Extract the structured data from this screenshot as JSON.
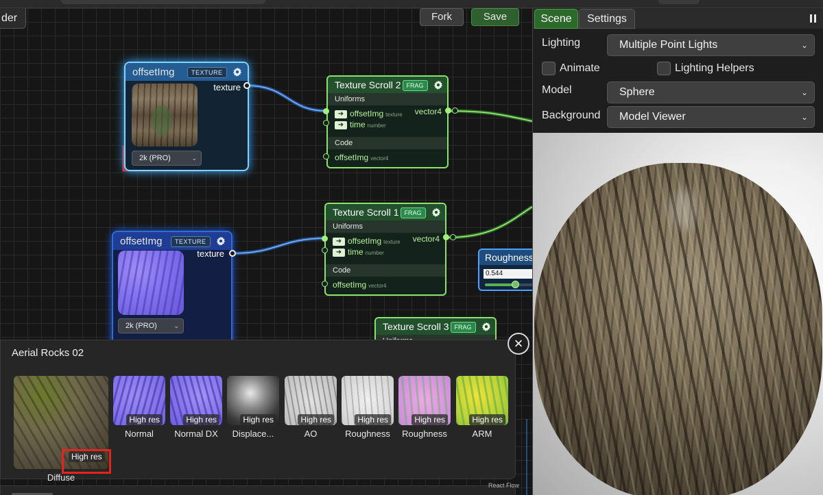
{
  "editor": {
    "tab_label": "der",
    "fork_label": "Fork",
    "save_label": "Save",
    "attribution": "React Flow"
  },
  "texture_nodes": [
    {
      "title": "offsetImg",
      "badge": "TEXTURE",
      "output": "texture",
      "resolution": "2k (PRO)",
      "thumbnail": "bark-texture",
      "selected": true
    },
    {
      "title": "offsetImg",
      "badge": "TEXTURE",
      "output": "texture",
      "resolution": "2k (PRO)",
      "thumbnail": "normal-map-texture",
      "selected": false
    }
  ],
  "shader_nodes": [
    {
      "title": "Texture Scroll 2",
      "badge": "FRAG",
      "uniforms_label": "Uniforms",
      "uniforms": [
        {
          "name": "offsetImg",
          "type": "texture"
        },
        {
          "name": "time",
          "type": "number"
        }
      ],
      "output": "vector4",
      "code_label": "Code",
      "code_input": {
        "name": "offsetImg",
        "type": "vector4"
      }
    },
    {
      "title": "Texture Scroll 1",
      "badge": "FRAG",
      "uniforms_label": "Uniforms",
      "uniforms": [
        {
          "name": "offsetImg",
          "type": "texture"
        },
        {
          "name": "time",
          "type": "number"
        }
      ],
      "output": "vector4",
      "code_label": "Code",
      "code_input": {
        "name": "offsetImg",
        "type": "vector4"
      }
    },
    {
      "title": "Texture Scroll 3",
      "badge": "FRAG",
      "uniforms_label": "Uniforms"
    }
  ],
  "roughness_node": {
    "title": "Roughness",
    "value": "0.544",
    "level": 0.544
  },
  "asset_panel": {
    "title": "Aerial Rocks 02",
    "close_icon": "close-icon",
    "maps": [
      {
        "label": "Diffuse",
        "badge": "High res",
        "kind": "diffuse"
      },
      {
        "label": "Normal",
        "badge": "High res",
        "kind": "normal"
      },
      {
        "label": "Normal DX",
        "badge": "High res",
        "kind": "normal-dx"
      },
      {
        "label": "Displace...",
        "badge": "High res",
        "kind": "displacement"
      },
      {
        "label": "AO",
        "badge": "High res",
        "kind": "ao"
      },
      {
        "label": "Roughness",
        "badge": "High res",
        "kind": "roughness"
      },
      {
        "label": "Roughness",
        "badge": "High res",
        "kind": "roughness-alt"
      },
      {
        "label": "ARM",
        "badge": "High res",
        "kind": "arm"
      }
    ]
  },
  "scene_panel": {
    "tabs": [
      {
        "label": "Scene",
        "active": true
      },
      {
        "label": "Settings",
        "active": false
      }
    ],
    "pause_icon": "pause-icon",
    "lighting": {
      "label": "Lighting",
      "value": "Multiple Point Lights"
    },
    "animate": {
      "label": "Animate",
      "checked": false
    },
    "lighting_helpers": {
      "label": "Lighting Helpers",
      "checked": false
    },
    "model": {
      "label": "Model",
      "value": "Sphere"
    },
    "background": {
      "label": "Background",
      "value": "Model Viewer"
    }
  },
  "colors": {
    "accent_green": "#8be36b",
    "texture_blue": "#4da3ff",
    "highlight_red": "#e8231c"
  }
}
